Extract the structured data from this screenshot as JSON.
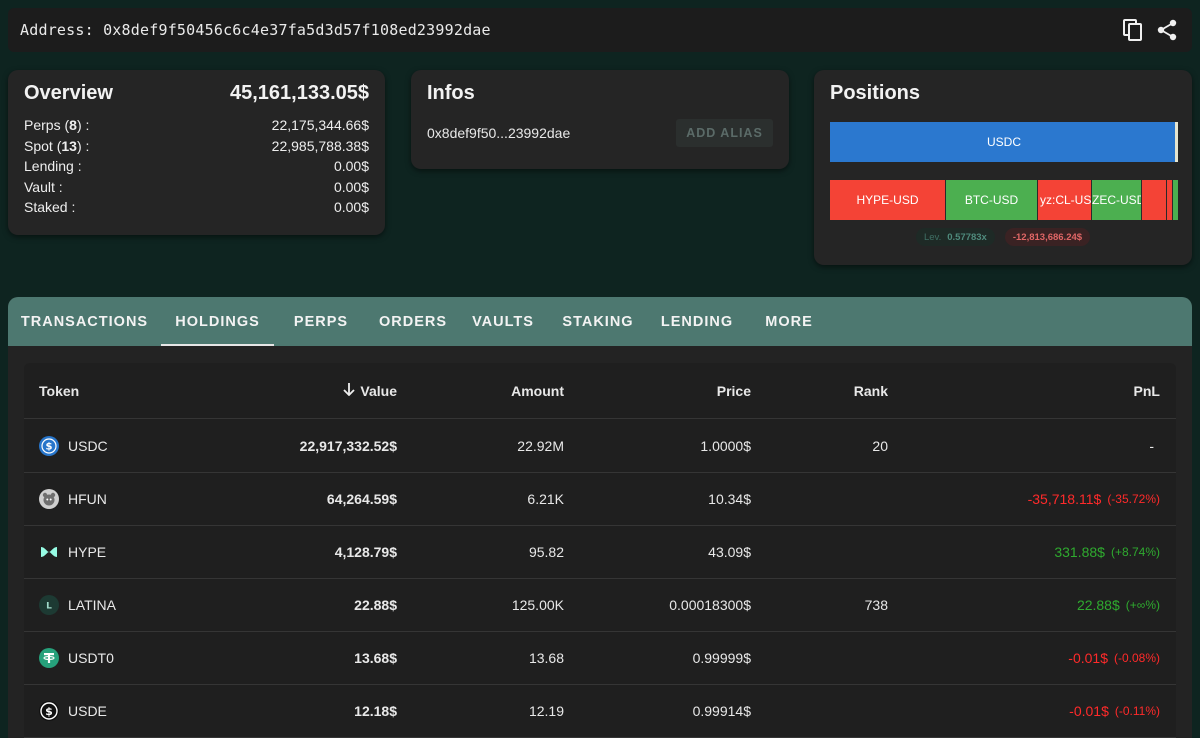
{
  "address": {
    "label": "Address: 0x8def9f50456c6c4e37fa5d3d57f108ed23992dae"
  },
  "overview": {
    "title": "Overview",
    "total": "45,161,133.05$",
    "rows": [
      {
        "label": "Perps",
        "count": "8",
        "suffix": " :",
        "value": "22,175,344.66$"
      },
      {
        "label": "Spot",
        "count": "13",
        "suffix": " :",
        "value": "22,985,788.38$"
      },
      {
        "label": "Lending :",
        "value": "0.00$"
      },
      {
        "label": "Vault :",
        "value": "0.00$"
      },
      {
        "label": "Staked :",
        "value": "0.00$"
      }
    ]
  },
  "infos": {
    "title": "Infos",
    "short_address": "0x8def9f50...23992dae",
    "alias_button": "ADD ALIAS"
  },
  "positions": {
    "title": "Positions",
    "spot_bar_label": "USDC",
    "perp_segments": [
      {
        "label": "HYPE-USD",
        "color": "red"
      },
      {
        "label": "BTC-USD",
        "color": "green"
      },
      {
        "label": "yz:CL-USD",
        "color": "red"
      },
      {
        "label": "ZEC-USD",
        "color": "green"
      },
      {
        "label": "",
        "color": "red"
      },
      {
        "label": "",
        "color": "red"
      },
      {
        "label": "",
        "color": "green"
      }
    ],
    "lev_label": "Lev.",
    "lev_value": "0.57783x",
    "pnl": "-12,813,686.24$"
  },
  "tabs": [
    "TRANSACTIONS",
    "HOLDINGS",
    "PERPS",
    "ORDERS",
    "VAULTS",
    "STAKING",
    "LENDING",
    "MORE"
  ],
  "active_tab": "HOLDINGS",
  "table": {
    "headers": {
      "token": "Token",
      "value": "Value",
      "amount": "Amount",
      "price": "Price",
      "rank": "Rank",
      "pnl": "PnL"
    },
    "rows": [
      {
        "token": "USDC",
        "icon": "usdc-icon",
        "value": "22,917,332.52$",
        "amount": "22.92M",
        "price": "1.0000$",
        "rank": "20",
        "pnl": "-",
        "pnl_pct": "",
        "pnl_sign": "none"
      },
      {
        "token": "HFUN",
        "icon": "hfun-icon",
        "value": "64,264.59$",
        "amount": "6.21K",
        "price": "10.34$",
        "rank": "",
        "pnl": "-35,718.11$",
        "pnl_pct": "(-35.72%)",
        "pnl_sign": "neg"
      },
      {
        "token": "HYPE",
        "icon": "hype-icon",
        "value": "4,128.79$",
        "amount": "95.82",
        "price": "43.09$",
        "rank": "",
        "pnl": "331.88$",
        "pnl_pct": "(+8.74%)",
        "pnl_sign": "pos"
      },
      {
        "token": "LATINA",
        "icon": "latina-icon",
        "value": "22.88$",
        "amount": "125.00K",
        "price": "0.00018300$",
        "rank": "738",
        "pnl": "22.88$",
        "pnl_pct": "(+∞%)",
        "pnl_sign": "pos"
      },
      {
        "token": "USDT0",
        "icon": "usdt0-icon",
        "value": "13.68$",
        "amount": "13.68",
        "price": "0.99999$",
        "rank": "",
        "pnl": "-0.01$",
        "pnl_pct": "(-0.08%)",
        "pnl_sign": "neg"
      },
      {
        "token": "USDE",
        "icon": "usde-icon",
        "value": "12.18$",
        "amount": "12.19",
        "price": "0.99914$",
        "rank": "",
        "pnl": "-0.01$",
        "pnl_pct": "(-0.11%)",
        "pnl_sign": "neg"
      }
    ]
  }
}
